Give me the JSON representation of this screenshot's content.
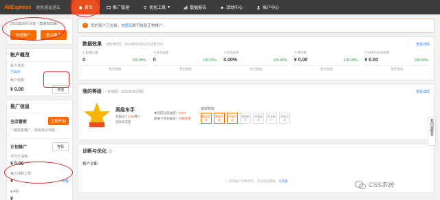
{
  "topbar": {
    "logo": "AliExpress",
    "shop": "速卖通直通车",
    "nav": [
      {
        "label": "首页",
        "icon": "home-icon",
        "active": true
      },
      {
        "label": "推广管理",
        "icon": "promote-icon",
        "active": false
      },
      {
        "label": "优化工具",
        "icon": "tool-icon",
        "active": false
      },
      {
        "label": "数据报告",
        "icon": "report-icon",
        "active": false
      },
      {
        "label": "活动中心",
        "icon": "activity-icon",
        "active": false
      },
      {
        "label": "账户中心",
        "icon": "account-icon",
        "active": false
      }
    ]
  },
  "left": {
    "promo_date": "2016年05月10日（直通车日期）",
    "btn_new": "快速推广",
    "btn_manage": "重点推广",
    "overview_title": "账户概览",
    "account_status_label": "账户状态：",
    "account_status": "已出价",
    "balance_label": "账户余额：",
    "balance": "¥ 0.00",
    "recharge": "充值",
    "info_title": "推广信息",
    "all_label": "全店管家",
    "all_btn": "立即开启",
    "all_desc": "一键配置推广，轻松抢占商机！",
    "plan_label": "计划推广",
    "plan_btn": "查看",
    "plan_today": "今日已消耗：",
    "plan_today_val": "¥ 0.00",
    "limit_label": "每日消耗上限：",
    "limit_val": "¥ ",
    "limit_edit": "调整",
    "pro_label": "A码",
    "pro_val": "¥"
  },
  "notice": {
    "text_a": "您的账户已欠费，",
    "link": "充值后",
    "text_b": "即可恢复正常推广。"
  },
  "data_panel": {
    "title": "数据效果",
    "subtitle": "（统计时间：2016年05月11日过去7日）",
    "more": "查看详情",
    "metrics": [
      {
        "label": "七日曝光量",
        "value": "0",
        "pct": "100.00%↓",
        "empty": "暂无数据"
      },
      {
        "label": "七日点击量",
        "value": "0",
        "pct": "100.00%↓",
        "empty": "暂无数据"
      },
      {
        "label": "七日点击率",
        "value": "0.00%",
        "pct": "100.00%↓",
        "empty": "暂无数据"
      },
      {
        "label": "七日花费",
        "value": "¥ 0.00",
        "pct": "100.00%↓",
        "empty": "暂无数据"
      },
      {
        "label": "七日平均点击花费",
        "value": "¥ 0.00",
        "pct": "100.00%↓",
        "empty": "暂无数据"
      }
    ]
  },
  "level_panel": {
    "title": "我的等级",
    "subtitle": "（考核期：2016年05月期）",
    "more": "查看详情",
    "badge_text": "车手",
    "level_name": "高级车手",
    "desc_a": "您超过了",
    "desc_pct": "12%",
    "desc_b": "用户",
    "desc_c": "团队的车友",
    "progress_a": "本月成长值进度：",
    "progress_a_val": "2322",
    "progress_b": "距离下次升级值：",
    "progress_b_val": "升级享受",
    "privs_title": "特权特权",
    "privs": [
      {
        "label": "精选直投",
        "on": true
      },
      {
        "label": "数据开放",
        "on": true
      },
      {
        "label": "专属活动",
        "on": true
      },
      {
        "label": "数据概况",
        "on": false
      },
      {
        "label": "专属顾问",
        "on": false
      },
      {
        "label": "更多推广",
        "on": false
      },
      {
        "label": "营销活动",
        "on": false
      }
    ]
  },
  "diag_panel": {
    "title": "诊断与优化",
    "sub": "账户诊断",
    "empty_a": "您的账户诊断不足，无法给出建议。请",
    "empty_link": "充值"
  },
  "side_help": "有问题联系",
  "watermark": "CSS系统",
  "colors": {
    "accent": "#ff6a00",
    "nav_active": "#e94f1d",
    "annotation": "#d8262a"
  }
}
